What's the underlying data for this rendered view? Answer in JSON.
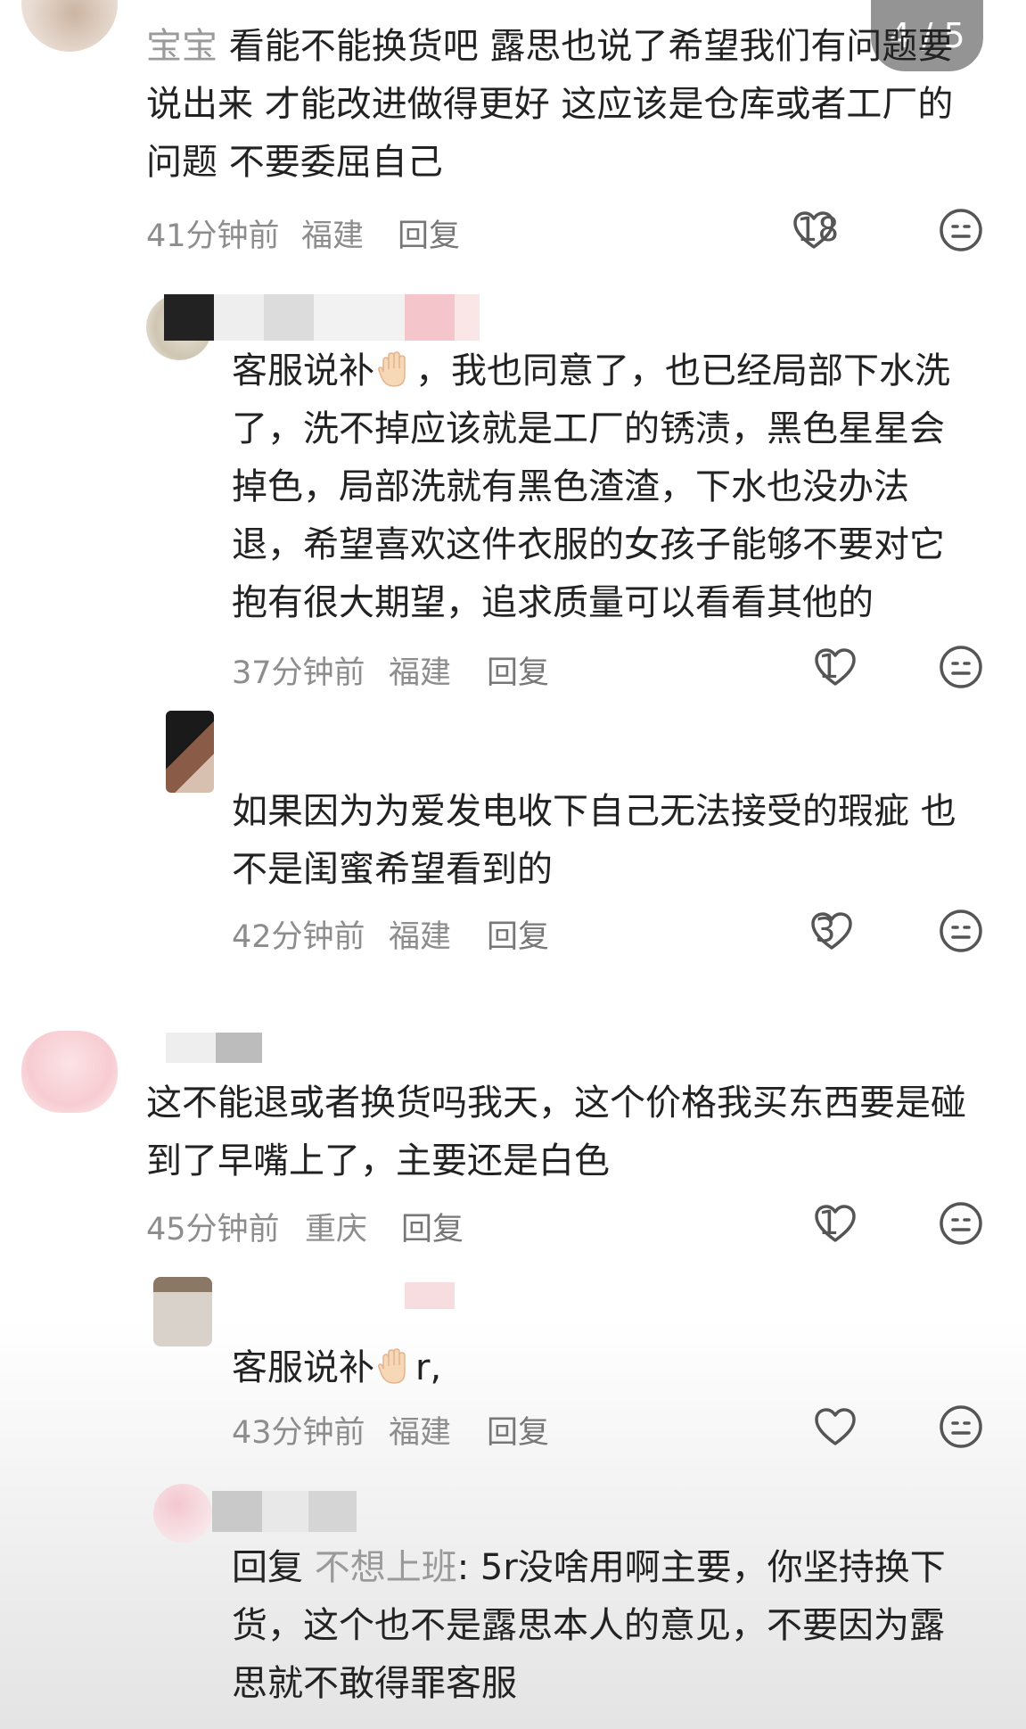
{
  "page_indicator": "4 / 5",
  "comments": [
    {
      "id": "c1",
      "type": "top",
      "truncated_prefix": "宝宝",
      "text": "看能不能换货吧 露思也说了希望我们有问题要说出来 才能改进做得更好 这应该是仓库或者工厂的问题 不要委屈自己",
      "time": "41分钟前",
      "location": "福建",
      "reply_label": "回复",
      "likes": "18"
    },
    {
      "id": "c2",
      "type": "reply",
      "text_before": "客服说补",
      "text_after": "，我也同意了，也已经局部下水洗了，洗不掉应该就是工厂的锈渍，黑色星星会掉色，局部洗就有黑色渣渣，下水也没办法退，希望喜欢这件衣服的女孩子能够不要对它抱有很大期望，追求质量可以看看其他的",
      "emoji": "waving-hand",
      "time": "37分钟前",
      "location": "福建",
      "reply_label": "回复",
      "likes": "1"
    },
    {
      "id": "c3",
      "type": "reply",
      "text": "如果因为为爱发电收下自己无法接受的瑕疵 也不是闺蜜希望看到的",
      "time": "42分钟前",
      "location": "福建",
      "reply_label": "回复",
      "likes": "3"
    },
    {
      "id": "c4",
      "type": "top",
      "text": "这不能退或者换货吗我天，这个价格我买东西要是碰到了早嘴上了，主要还是白色",
      "time": "45分钟前",
      "location": "重庆",
      "reply_label": "回复",
      "likes": "1"
    },
    {
      "id": "c5",
      "type": "reply",
      "text_before": "客服说补",
      "text_after": "r,",
      "emoji": "waving-hand",
      "time": "43分钟前",
      "location": "福建",
      "reply_label": "回复",
      "likes": ""
    },
    {
      "id": "c6",
      "type": "reply",
      "reply_prefix": "回复",
      "reply_target": "不想上班",
      "text": ": 5r没啥用啊主要，你坚持换下货，这个也不是露思本人的意见，不要因为露思就不敢得罪客服"
    }
  ],
  "icons": {
    "like": "heart-outline-icon",
    "reaction": "neutral-face-icon",
    "emoji": "waving-hand-emoji"
  },
  "colors": {
    "meta": "#8d8d8d",
    "text": "#222222",
    "icon": "#555555"
  }
}
